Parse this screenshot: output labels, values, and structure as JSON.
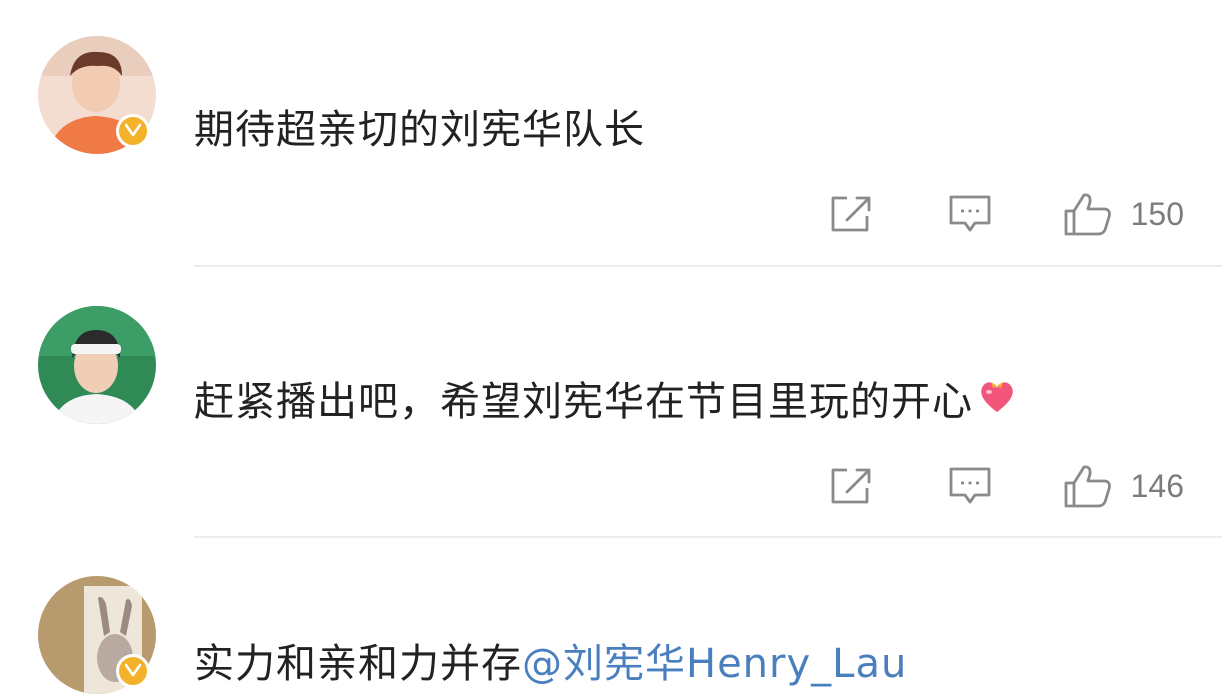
{
  "comments": [
    {
      "text": "期待超亲切的刘宪华队长",
      "like_count": "150",
      "verified": true
    },
    {
      "text": "赶紧播出吧，希望刘宪华在节目里玩的开心",
      "emoji": "heart-with-bow-emoji",
      "like_count": "146",
      "verified": false
    },
    {
      "text": "实力和亲和力并存",
      "mention": "@刘宪华Henry_Lau",
      "verified": true
    }
  ],
  "icons": {
    "share": "share-icon",
    "reply": "comment-icon",
    "like": "thumbs-up-icon",
    "verified": "verified-badge-icon"
  },
  "colors": {
    "text": "#222222",
    "mention": "#4a7fbf",
    "icon": "#8a8a8a",
    "verified": "#f4b12a",
    "divider": "#ececec"
  }
}
